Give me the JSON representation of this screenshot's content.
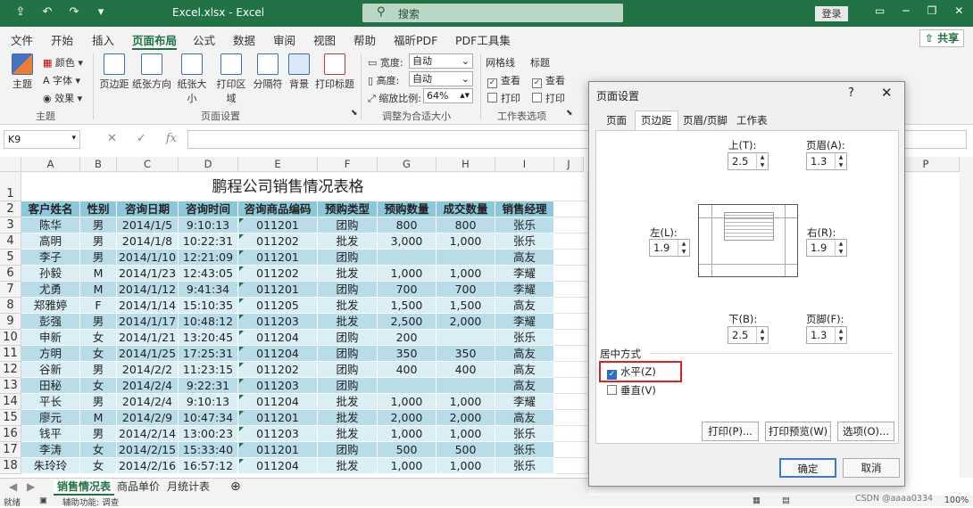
{
  "window": {
    "title": "Excel.xlsx - Excel",
    "search_placeholder": "搜索",
    "login": "登录",
    "share": "共享"
  },
  "menu": [
    "文件",
    "开始",
    "插入",
    "页面布局",
    "公式",
    "数据",
    "审阅",
    "视图",
    "帮助",
    "福昕PDF",
    "PDF工具集"
  ],
  "ribbon": {
    "theme": {
      "themes": "主题",
      "colors": "颜色",
      "fonts": "字体",
      "effects": "效果",
      "group": "主题"
    },
    "setup": {
      "margins": "页边距",
      "orientation": "纸张方向",
      "size": "纸张大小",
      "print_area": "打印区域",
      "breaks": "分隔符",
      "background": "背景",
      "print_titles": "打印标题",
      "group": "页面设置"
    },
    "scale": {
      "width_label": "宽度:",
      "width_value": "自动",
      "height_label": "高度:",
      "height_value": "自动",
      "scale_label": "缩放比例:",
      "scale_value": "64%",
      "group": "调整为合适大小"
    },
    "sheet_options": {
      "gridlines": "网格线",
      "headings": "标题",
      "view": "查看",
      "print": "打印",
      "group": "工作表选项"
    }
  },
  "formula_bar": {
    "name_box": "K9",
    "fx": "fx"
  },
  "columns": [
    "A",
    "B",
    "C",
    "D",
    "E",
    "F",
    "G",
    "H",
    "I",
    "J",
    "P"
  ],
  "rows": [
    "1",
    "2",
    "3",
    "4",
    "5",
    "6",
    "7",
    "8",
    "9",
    "10",
    "11",
    "12",
    "13",
    "14",
    "15",
    "16",
    "17",
    "18"
  ],
  "sheet": {
    "title": "鹏程公司销售情况表格",
    "headers": [
      "客户姓名",
      "性别",
      "咨询日期",
      "咨询时间",
      "咨询商品编码",
      "预购类型",
      "预购数量",
      "成交数量",
      "销售经理"
    ],
    "data": [
      [
        "陈华",
        "男",
        "2014/1/5",
        "9:10:13",
        "011201",
        "团购",
        "800",
        "800",
        "张乐"
      ],
      [
        "高明",
        "男",
        "2014/1/8",
        "10:22:31",
        "011202",
        "批发",
        "3,000",
        "1,000",
        "张乐"
      ],
      [
        "李子",
        "男",
        "2014/1/10",
        "12:21:09",
        "011201",
        "团购",
        "",
        "",
        "高友"
      ],
      [
        "孙毅",
        "M",
        "2014/1/23",
        "12:43:05",
        "011202",
        "批发",
        "1,000",
        "1,000",
        "李耀"
      ],
      [
        "尤勇",
        "M",
        "2014/1/12",
        "9:41:34",
        "011201",
        "团购",
        "700",
        "700",
        "李耀"
      ],
      [
        "郑雅婷",
        "F",
        "2014/1/14",
        "15:10:35",
        "011205",
        "批发",
        "1,500",
        "1,500",
        "高友"
      ],
      [
        "彭强",
        "男",
        "2014/1/17",
        "10:48:12",
        "011203",
        "批发",
        "2,500",
        "2,000",
        "李耀"
      ],
      [
        "申新",
        "女",
        "2014/1/21",
        "13:20:45",
        "011204",
        "团购",
        "200",
        "",
        "张乐"
      ],
      [
        "方明",
        "女",
        "2014/1/25",
        "17:25:31",
        "011204",
        "团购",
        "350",
        "350",
        "高友"
      ],
      [
        "谷新",
        "男",
        "2014/2/2",
        "11:23:15",
        "011202",
        "团购",
        "400",
        "400",
        "高友"
      ],
      [
        "田秘",
        "女",
        "2014/2/4",
        "9:22:31",
        "011203",
        "团购",
        "",
        "",
        "高友"
      ],
      [
        "平长",
        "男",
        "2014/2/4",
        "9:10:13",
        "011204",
        "批发",
        "1,000",
        "1,000",
        "李耀"
      ],
      [
        "廖元",
        "M",
        "2014/2/9",
        "10:47:34",
        "011201",
        "批发",
        "2,000",
        "2,000",
        "高友"
      ],
      [
        "钱平",
        "男",
        "2014/2/14",
        "13:00:23",
        "011203",
        "批发",
        "1,000",
        "1,000",
        "张乐"
      ],
      [
        "李涛",
        "女",
        "2014/2/15",
        "15:33:40",
        "011201",
        "团购",
        "500",
        "500",
        "张乐"
      ],
      [
        "朱玲玲",
        "女",
        "2014/2/16",
        "16:57:12",
        "011204",
        "批发",
        "1,000",
        "1,000",
        "张乐"
      ]
    ]
  },
  "sheet_tabs": [
    "销售情况表",
    "商品单价",
    "月统计表"
  ],
  "status": {
    "ready": "就绪",
    "accessibility": "辅助功能: 调查",
    "zoom": "100%",
    "watermark": "CSDN @aaaa0334"
  },
  "dialog": {
    "title": "页面设置",
    "help": "?",
    "tabs": [
      "页面",
      "页边距",
      "页眉/页脚",
      "工作表"
    ],
    "top_label": "上(T):",
    "top_value": "2.5",
    "header_label": "页眉(A):",
    "header_value": "1.3",
    "left_label": "左(L):",
    "left_value": "1.9",
    "right_label": "右(R):",
    "right_value": "1.9",
    "bottom_label": "下(B):",
    "bottom_value": "2.5",
    "footer_label": "页脚(F):",
    "footer_value": "1.3",
    "center_group": "居中方式",
    "horizontal": "水平(Z)",
    "horizontal_checked": true,
    "vertical": "垂直(V)",
    "vertical_checked": false,
    "print_btn": "打印(P)...",
    "preview_btn": "打印预览(W)",
    "options_btn": "选项(O)...",
    "ok": "确定",
    "cancel": "取消"
  }
}
